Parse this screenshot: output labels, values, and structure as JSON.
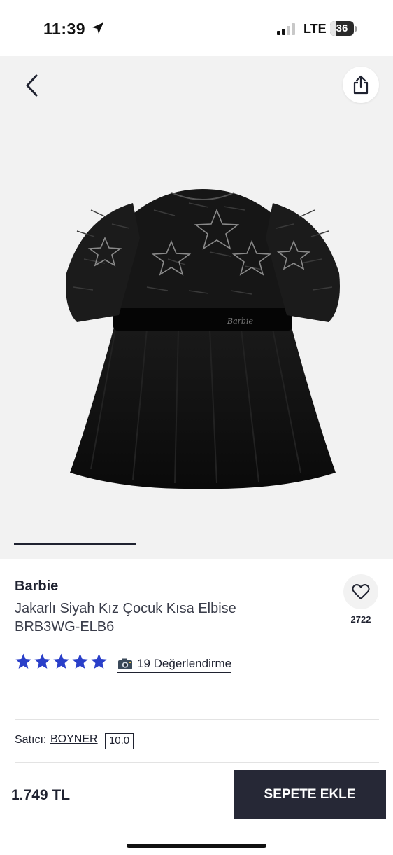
{
  "status_bar": {
    "time": "11:39",
    "network": "LTE",
    "battery": "36"
  },
  "icons": {
    "back": "back-chevron-icon",
    "share": "share-icon",
    "favorite": "heart-icon",
    "location": "location-arrow-icon",
    "camera": "camera-icon",
    "star": "star-icon"
  },
  "gallery": {
    "image_alt": "black dress",
    "current_index": 1,
    "total_images_visible_indicator": 3
  },
  "product": {
    "brand": "Barbie",
    "title": "Jakarlı Siyah Kız Çocuk Kısa Elbise BRB3WG-ELB6",
    "favorite_count": "2722",
    "rating_stars": 5,
    "reviews_label": "19 Değerlendirme"
  },
  "seller": {
    "label": "Satıcı:",
    "name": "BOYNER",
    "score": "10.0"
  },
  "purchase": {
    "price": "1.749 TL",
    "add_to_cart_label": "SEPETE EKLE"
  },
  "colors": {
    "accent": "#262836",
    "star": "#2a3fc9",
    "gallery_bg": "#f2f2f2"
  }
}
